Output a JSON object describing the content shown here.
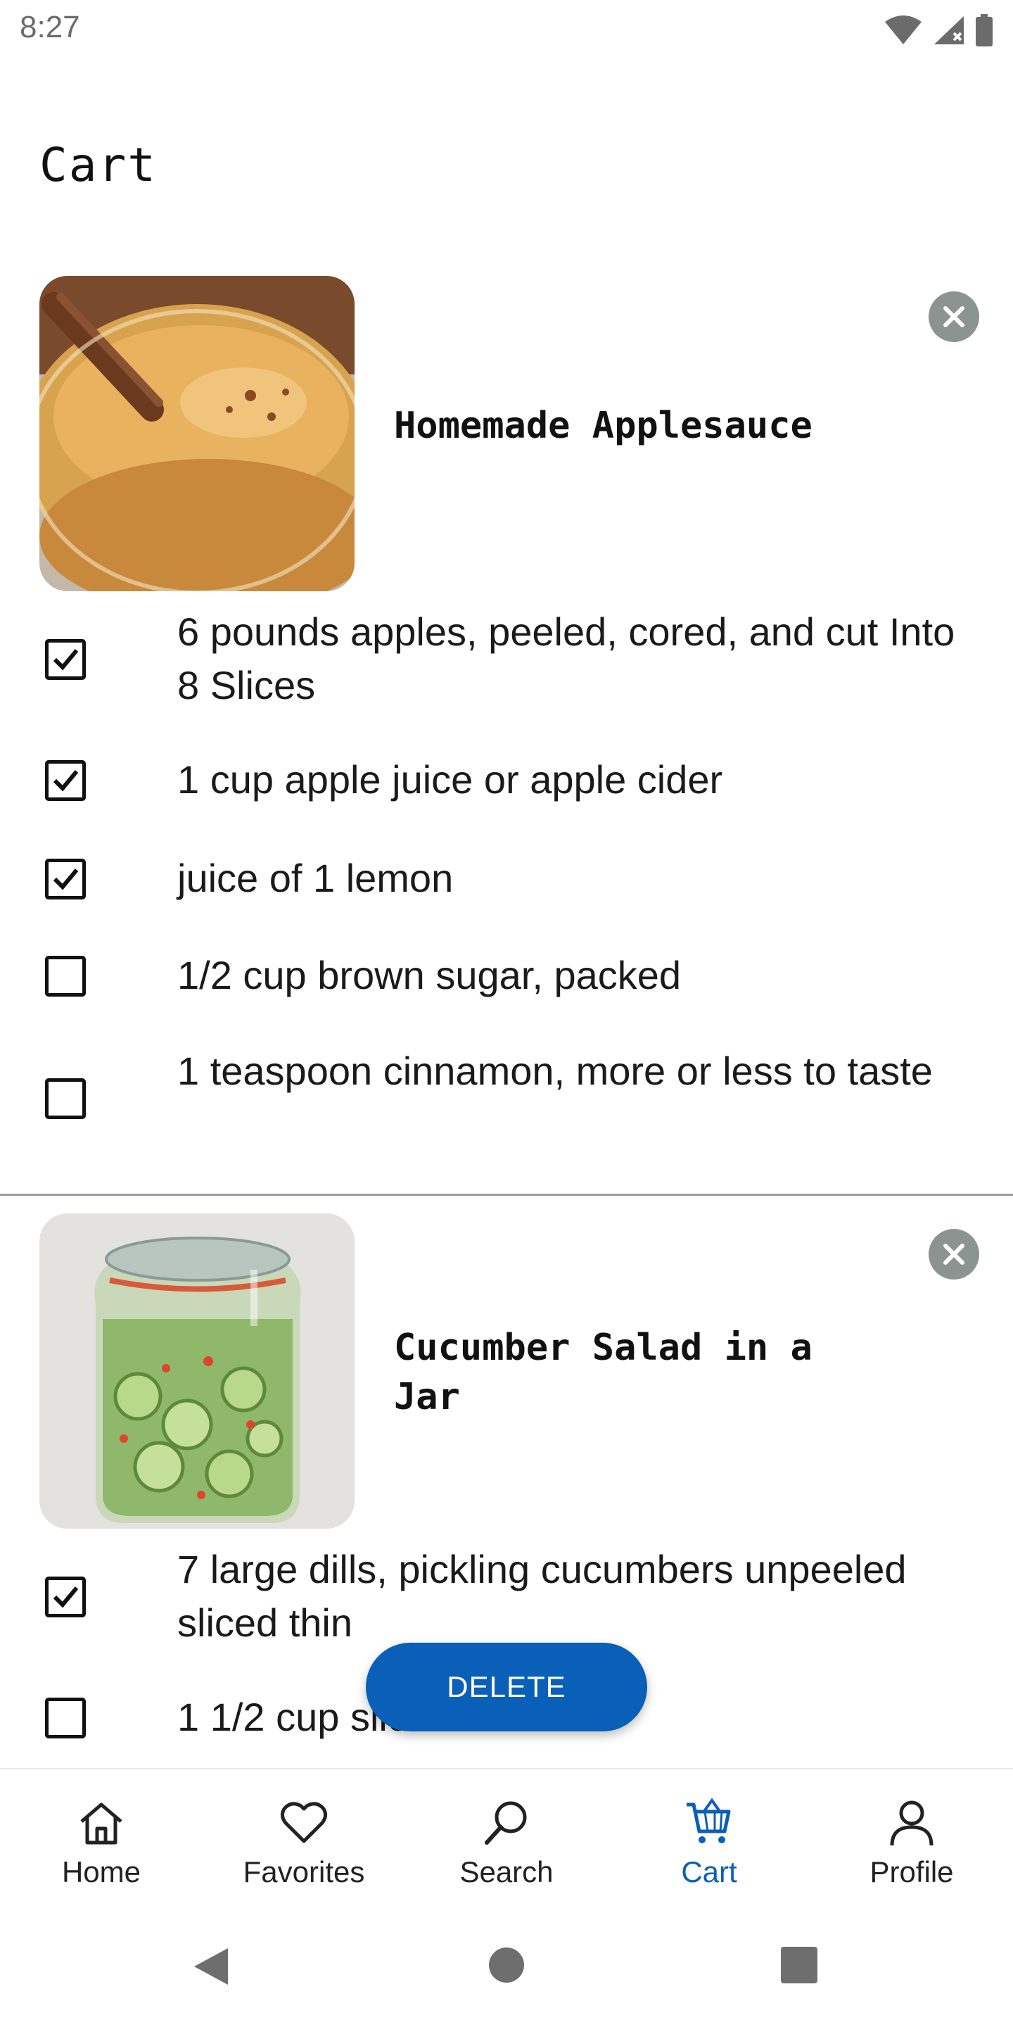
{
  "status_bar": {
    "time": "8:27"
  },
  "page": {
    "title": "Cart"
  },
  "recipes": [
    {
      "title": "Homemade Applesauce",
      "ingredients": [
        {
          "text": "6 pounds apples, peeled, cored, and cut Into 8 Slices",
          "checked": true
        },
        {
          "text": "1 cup apple juice or apple cider",
          "checked": true
        },
        {
          "text": "juice of 1 lemon",
          "checked": true
        },
        {
          "text": "1/2 cup brown sugar, packed",
          "checked": false
        },
        {
          "text": "1 teaspoon cinnamon, more or less to taste",
          "checked": false
        }
      ]
    },
    {
      "title": "Cucumber Salad in a Jar",
      "ingredients": [
        {
          "text": "7 large dills, pickling cucumbers unpeeled sliced thin",
          "checked": true
        },
        {
          "text": "1 1/2 cup sliced onions",
          "checked": false
        }
      ]
    }
  ],
  "actions": {
    "delete_label": "DELETE"
  },
  "bottom_nav": {
    "items": [
      {
        "label": "Home",
        "icon": "home-icon"
      },
      {
        "label": "Favorites",
        "icon": "heart-icon"
      },
      {
        "label": "Search",
        "icon": "search-icon"
      },
      {
        "label": "Cart",
        "icon": "cart-icon",
        "active": true
      },
      {
        "label": "Profile",
        "icon": "person-icon"
      }
    ]
  },
  "colors": {
    "accent": "#0a5fb8",
    "remove_button": "#8c9492",
    "divider": "#9a9a9a"
  }
}
